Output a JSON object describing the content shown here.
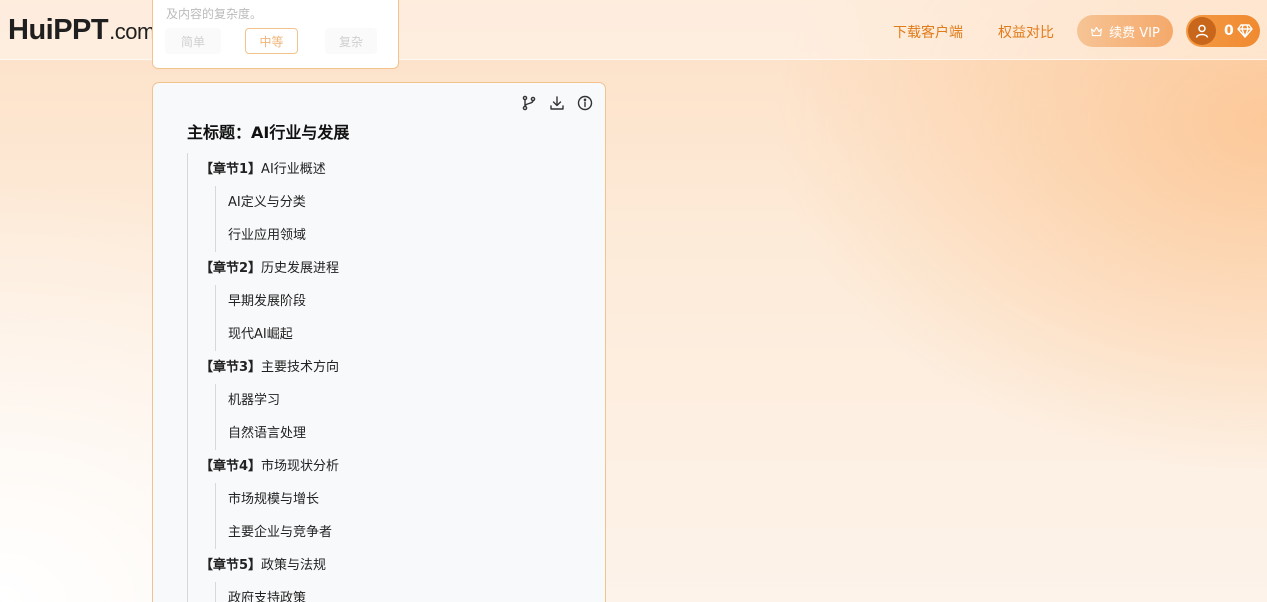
{
  "header": {
    "logo_main": "HuiPPT",
    "logo_suffix": ".com",
    "nav_download": "下载客户端",
    "nav_compare": "权益对比",
    "vip_label": "续费 VIP",
    "coin_count": "0",
    "accent": "#e07b1a"
  },
  "prev_card": {
    "desc": "及内容的复杂度。",
    "options": [
      "简单",
      "中等",
      "复杂"
    ],
    "selected": "中等"
  },
  "outline": {
    "title": "主标题：AI行业与发展",
    "tools": [
      "branch-icon",
      "download-icon",
      "info-icon"
    ],
    "chapters": [
      {
        "tag": "【章节1】",
        "name": "AI行业概述",
        "subs": [
          "AI定义与分类",
          "行业应用领域"
        ]
      },
      {
        "tag": "【章节2】",
        "name": "历史发展进程",
        "subs": [
          "早期发展阶段",
          "现代AI崛起"
        ]
      },
      {
        "tag": "【章节3】",
        "name": "主要技术方向",
        "subs": [
          "机器学习",
          "自然语言处理"
        ]
      },
      {
        "tag": "【章节4】",
        "name": "市场现状分析",
        "subs": [
          "市场规模与增长",
          "主要企业与竞争者"
        ]
      },
      {
        "tag": "【章节5】",
        "name": "政策与法规",
        "subs": [
          "政府支持政策"
        ]
      }
    ]
  }
}
